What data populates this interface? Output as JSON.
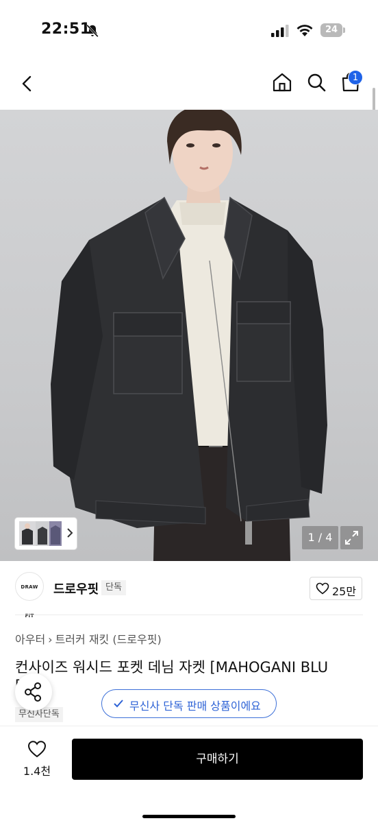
{
  "status_bar": {
    "time": "22:51",
    "battery_level": "24"
  },
  "nav": {
    "cart_count": "1"
  },
  "gallery": {
    "page_counter": "1 / 4"
  },
  "brand": {
    "logo_text": "DRAW FIT",
    "name": "드로우핏",
    "tag": "단독",
    "like_count": "25만"
  },
  "breadcrumb": {
    "category": "아우터",
    "separator": "›",
    "subcategory": "트러커 재킷 (드로우핏)"
  },
  "product": {
    "title_line1": "컨사이즈 워시드 포켓 데님 자켓 [MAHOGANI BLU",
    "title_line2": "[",
    "exclusive_tag": "무신사단독"
  },
  "banner": {
    "text": "무신사 단독 판매 상품이에요"
  },
  "bottom_bar": {
    "wish_count": "1.4천",
    "buy_label": "구매하기"
  },
  "colors": {
    "accent_blue": "#2e63d6",
    "badge_blue": "#1f63e8",
    "buy_button": "#000000"
  },
  "icons": [
    "bell-off-icon",
    "signal-icon",
    "wifi-icon",
    "battery-icon",
    "back-icon",
    "home-icon",
    "search-icon",
    "bag-icon",
    "chevron-right-icon",
    "expand-icon",
    "heart-icon",
    "share-icon",
    "check-icon"
  ]
}
